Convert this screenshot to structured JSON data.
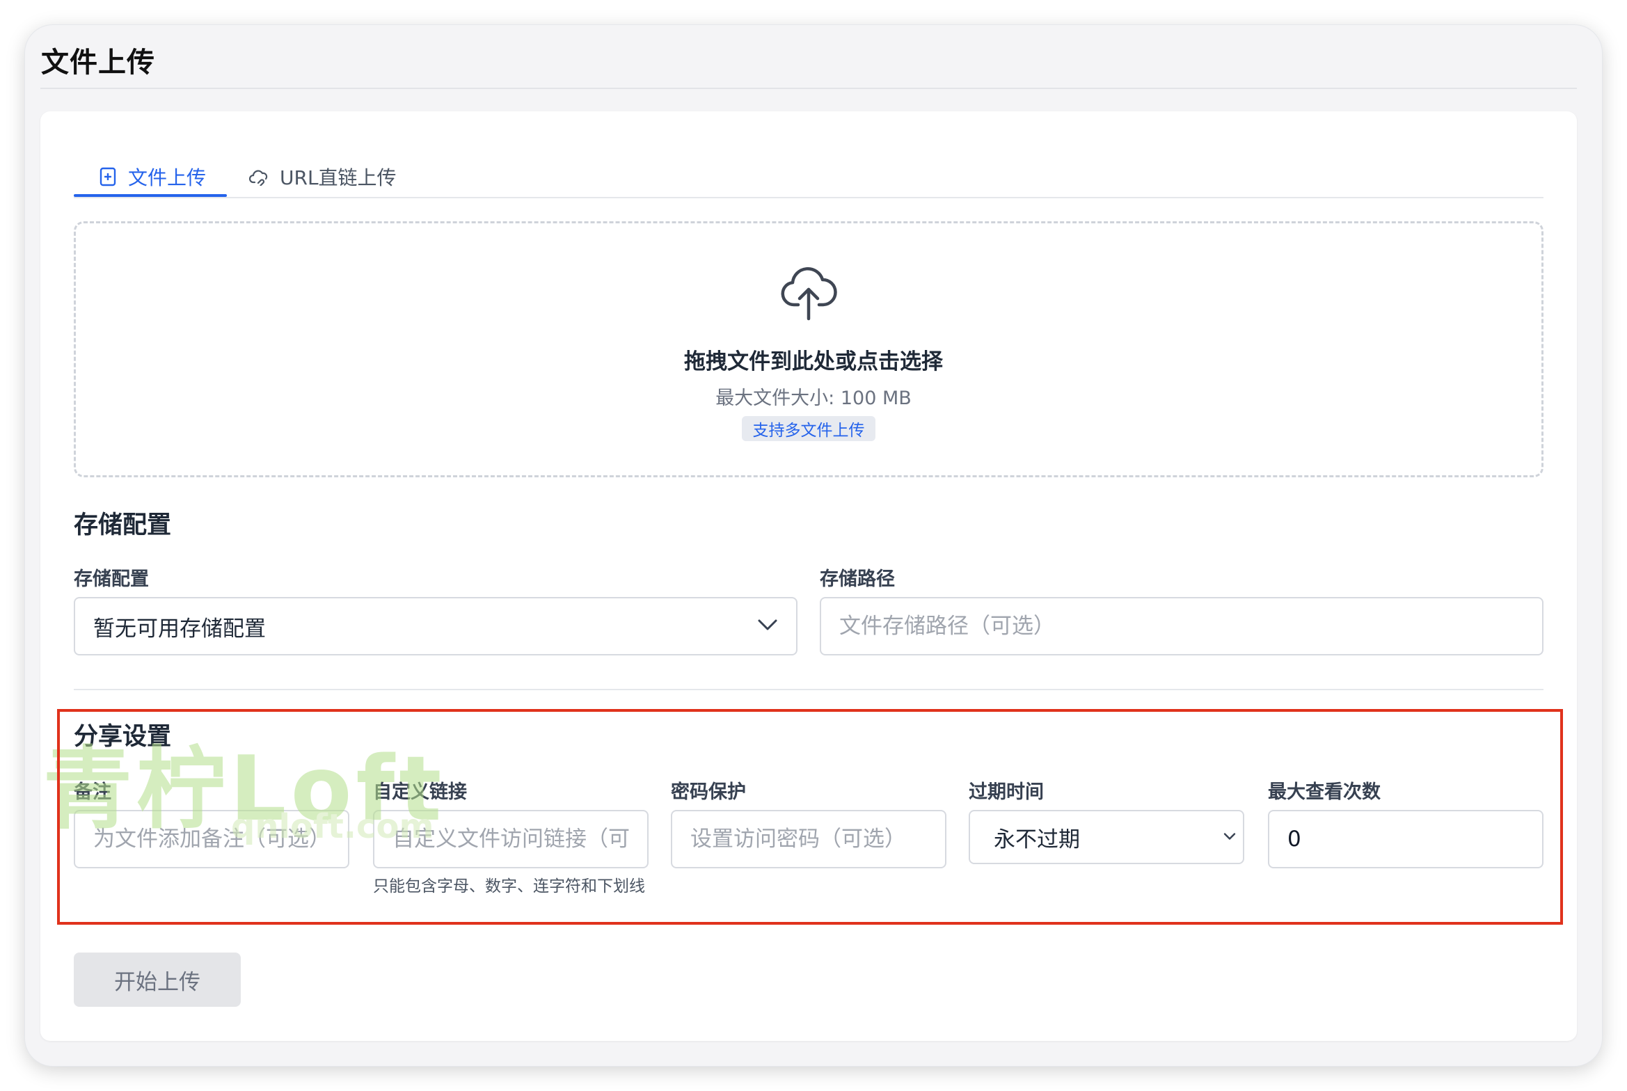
{
  "page": {
    "title": "文件上传"
  },
  "tabs": [
    {
      "label": "文件上传",
      "icon": "file-plus-icon",
      "active": true
    },
    {
      "label": "URL直链上传",
      "icon": "cloud-link-icon",
      "active": false
    }
  ],
  "dropzone": {
    "title": "拖拽文件到此处或点击选择",
    "subtitle": "最大文件大小: 100 MB",
    "badge": "支持多文件上传",
    "icon": "cloud-upload-icon"
  },
  "storage": {
    "section_title": "存储配置",
    "config_label": "存储配置",
    "config_value": "暂无可用存储配置",
    "path_label": "存储路径",
    "path_placeholder": "文件存储路径（可选）"
  },
  "share": {
    "section_title": "分享设置",
    "note_label": "备注",
    "note_placeholder": "为文件添加备注（可选）",
    "custom_link_label": "自定义链接",
    "custom_link_placeholder": "自定义文件访问链接（可选）",
    "custom_link_helper": "只能包含字母、数字、连字符和下划线",
    "password_label": "密码保护",
    "password_placeholder": "设置访问密码（可选）",
    "expire_label": "过期时间",
    "expire_value": "永不过期",
    "max_views_label": "最大查看次数",
    "max_views_value": "0"
  },
  "actions": {
    "start_upload": "开始上传"
  },
  "watermark": {
    "text": "青柠Loft",
    "url": "qnloft.com"
  },
  "colors": {
    "accent": "#2563eb",
    "highlight": "#e0321c"
  }
}
